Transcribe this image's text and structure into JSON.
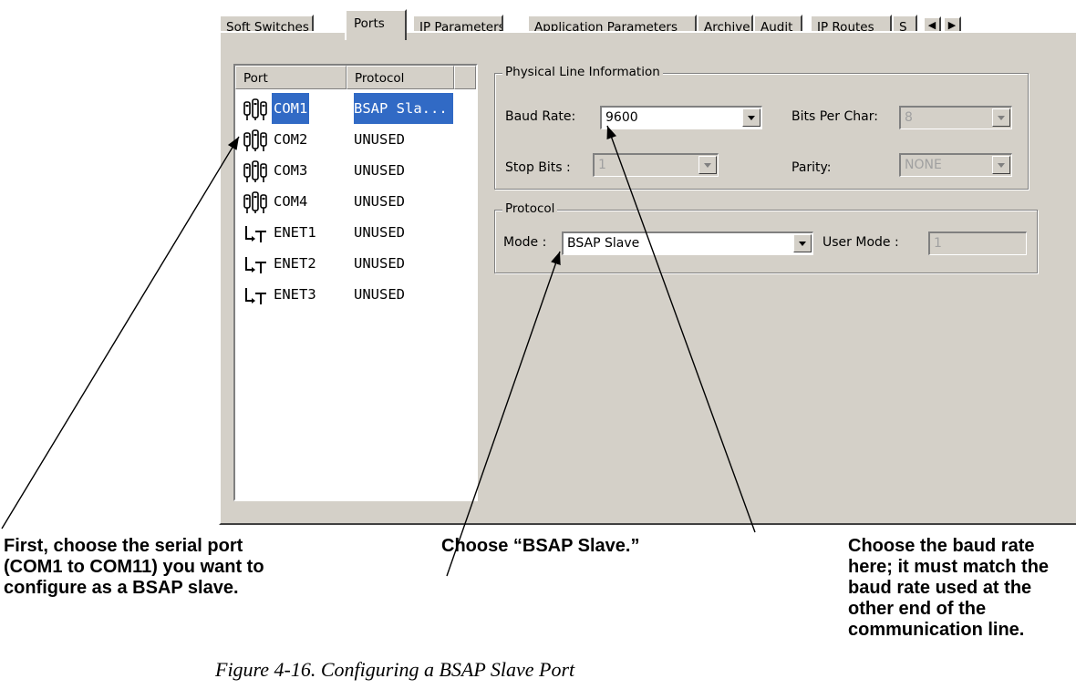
{
  "tabs": [
    "Soft Switches",
    "Ports",
    "IP Parameters",
    "Application Parameters",
    "Archive",
    "Audit",
    "IP Routes",
    "S"
  ],
  "active_tab": "Ports",
  "port_list": {
    "columns": [
      "Port",
      "Protocol"
    ],
    "rows": [
      {
        "port": "COM1",
        "protocol": "BSAP Sla...",
        "icon": "serial-port-icon",
        "selected": true
      },
      {
        "port": "COM2",
        "protocol": "UNUSED",
        "icon": "serial-port-icon"
      },
      {
        "port": "COM3",
        "protocol": "UNUSED",
        "icon": "serial-port-icon"
      },
      {
        "port": "COM4",
        "protocol": "UNUSED",
        "icon": "serial-port-icon"
      },
      {
        "port": "ENET1",
        "protocol": "UNUSED",
        "icon": "ethernet-port-icon"
      },
      {
        "port": "ENET2",
        "protocol": "UNUSED",
        "icon": "ethernet-port-icon"
      },
      {
        "port": "ENET3",
        "protocol": "UNUSED",
        "icon": "ethernet-port-icon"
      }
    ]
  },
  "physical": {
    "title": "Physical Line Information",
    "baud_label": "Baud Rate:",
    "baud_value": "9600",
    "bits_label": "Bits Per Char:",
    "bits_value": "8",
    "stop_label": "Stop Bits :",
    "stop_value": "1",
    "parity_label": "Parity:",
    "parity_value": "NONE"
  },
  "protocol": {
    "title": "Protocol",
    "mode_label": "Mode :",
    "mode_value": "BSAP Slave",
    "user_mode_label": "User Mode :",
    "user_mode_value": "1"
  },
  "annotations": {
    "left": "First, choose the serial port (COM1 to COM11) you want to configure as a BSAP slave.",
    "middle": "Choose “BSAP Slave.”",
    "right": "Choose the baud rate here; it must match the baud rate used at the other end of the communication line."
  },
  "caption": "Figure 4-16. Configuring a BSAP Slave Port",
  "colors": {
    "dialog": "#d4d0c8",
    "selection": "#316ac5"
  }
}
